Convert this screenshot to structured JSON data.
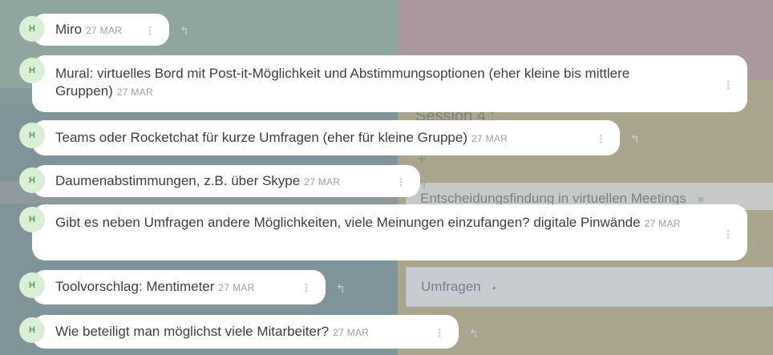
{
  "board": {
    "session_title": "Session 4 :",
    "add_icon": "plus-icon",
    "cards": [
      {
        "label": "Entscheidungsfindung in virtuellen Meetings",
        "icon": "description-lines-icon"
      },
      {
        "label": "Umfragen",
        "icon": "comment-icon"
      }
    ]
  },
  "comments": [
    {
      "avatar": "H",
      "text": "Miro",
      "date": "27 MAR"
    },
    {
      "avatar": "H",
      "text": "Mural: virtuelles Bord mit Post-it-Möglichkeit und Abstimmungsoptionen (eher kleine bis mittlere Gruppen)",
      "date": "27 MAR"
    },
    {
      "avatar": "H",
      "text": "Teams oder Rocketchat für kurze Umfragen (eher für kleine Gruppe)",
      "date": "27 MAR"
    },
    {
      "avatar": "H",
      "text": "Daumenabstimmungen, z.B. über Skype",
      "date": "27 MAR"
    },
    {
      "avatar": "H",
      "text": "Gibt es neben Umfragen andere Möglichkeiten, viele Meinungen einzufangen? digitale Pinwände",
      "date": "27 MAR"
    },
    {
      "avatar": "H",
      "text": "Toolvorschlag: Mentimeter",
      "date": "27 MAR"
    },
    {
      "avatar": "H",
      "text": "Wie beteiligt man möglichst viele Mitarbeiter?",
      "date": "27 MAR"
    }
  ],
  "icons": {
    "menu": "more-vertical-icon",
    "reply": "reply-icon"
  },
  "colors": {
    "avatar_bg": "#d9f0d6",
    "avatar_text": "#5b9b5a",
    "bubble": "#ffffff"
  }
}
